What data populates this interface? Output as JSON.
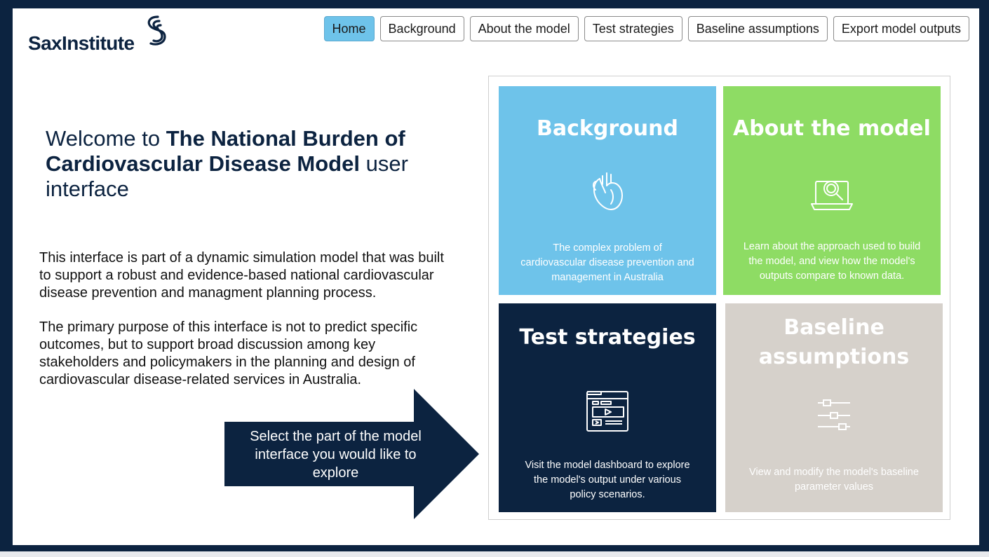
{
  "logo": {
    "text": "SaxInstitute"
  },
  "nav": {
    "items": [
      "Home",
      "Background",
      "About the model",
      "Test strategies",
      "Baseline assumptions",
      "Export model outputs"
    ],
    "active": "Home"
  },
  "welcome": {
    "prefix": "Welcome to ",
    "bold": "The National Burden of Cardiovascular Disease Model",
    "suffix": " user interface"
  },
  "intro": {
    "p1": "This interface is part of a dynamic simulation model that was built to support a robust and evidence-based national cardiovascular disease prevention and managment planning process.",
    "p2": "The primary purpose of this interface is not to predict specific outcomes, but to support broad discussion among key stakeholders and policymakers in the planning and design of cardiovascular disease-related services in Australia."
  },
  "callout": {
    "text": "Select the part of the model interface you would like to explore"
  },
  "tiles": [
    {
      "title": "Background",
      "icon": "heart-icon",
      "desc": "The complex problem of cardiovascular disease prevention and management in Australia"
    },
    {
      "title": "About the model",
      "icon": "laptop-magnifier-icon",
      "desc": "Learn about the approach used to build the model, and view how the model's outputs compare to known data."
    },
    {
      "title": "Test strategies",
      "icon": "dashboard-window-icon",
      "desc": "Visit the model dashboard to explore the model's output under various policy scenarios."
    },
    {
      "title": "Baseline assumptions",
      "icon": "sliders-icon",
      "desc": "View and modify the model's baseline parameter values"
    }
  ],
  "colors": {
    "navy": "#0c2340",
    "blue": "#6ec3ea",
    "green": "#8edc64",
    "beige": "#d6d1cb"
  }
}
